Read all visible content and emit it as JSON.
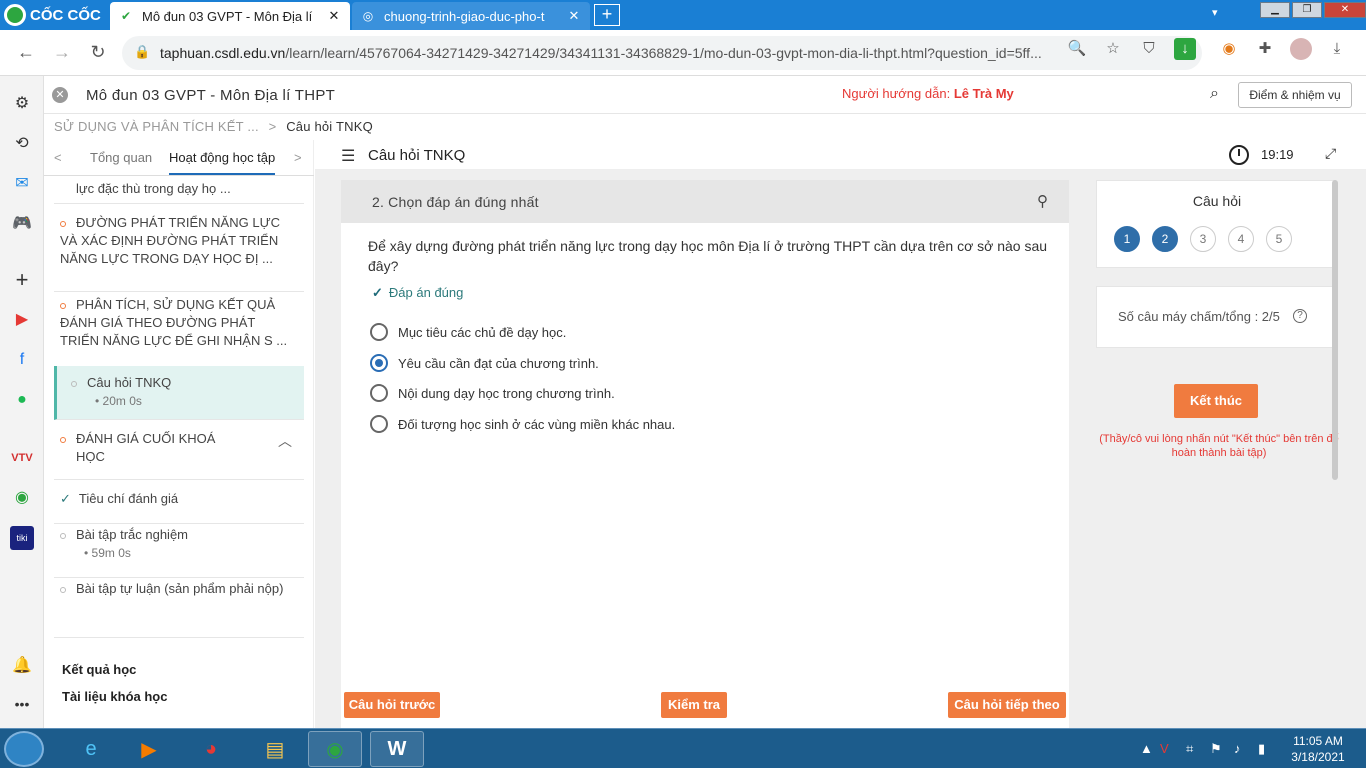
{
  "browser": {
    "logo": "CỐC CỐC",
    "tabs": [
      {
        "label": "Mô đun 03 GVPT - Môn Địa lí",
        "close": "✕"
      },
      {
        "label": "chuong-trinh-giao-duc-pho-t",
        "close": "✕"
      }
    ],
    "new_tab": "+",
    "url_host": "taphuan.csdl.edu.vn",
    "url_path": "/learn/learn/45767064-34271429-34271429/34341131-34368829-1/mo-dun-03-gvpt-mon-dia-li-thpt.html?question_id=5ff..."
  },
  "header": {
    "title": "Mô đun 03 GVPT - Môn Địa lí THPT",
    "guide_label": "Người hướng dẫn:",
    "guide_name": "Lê Trà My",
    "score_button": "Điểm & nhiệm vụ"
  },
  "breadcrumb": {
    "parent": "SỬ DỤNG VÀ PHÂN TÍCH KẾT ...",
    "sep": ">",
    "current": "Câu hỏi TNKQ"
  },
  "sidebar": {
    "tab_overview": "Tổng quan",
    "tab_activities": "Hoạt động học tập",
    "prev": "<",
    "next": ">",
    "items": [
      {
        "text": "lực đặc thù trong dạy họ ..."
      },
      {
        "text": "ĐƯỜNG PHÁT TRIỂN NĂNG LỰC VÀ XÁC ĐỊNH ĐƯỜNG PHÁT TRIỂN NĂNG LỰC TRONG DẠY HỌC ĐỊ ..."
      },
      {
        "text": "PHÂN TÍCH, SỬ DỤNG KẾT QUẢ ĐÁNH GIÁ THEO ĐƯỜNG PHÁT TRIỂN NĂNG LỰC ĐỂ GHI NHẬN S ..."
      },
      {
        "text": "Câu hỏi TNKQ",
        "duration": "• 20m 0s"
      },
      {
        "text": "ĐÁNH GIÁ CUỐI KHOÁ HỌC"
      },
      {
        "text": "Tiêu chí đánh giá"
      },
      {
        "text": "Bài tập trắc nghiệm",
        "duration": "• 59m 0s"
      },
      {
        "text": "Bài tập tự luận (sản phẩm phải nộp)"
      }
    ],
    "results": "Kết quả học",
    "materials": "Tài liệu khóa học"
  },
  "content": {
    "title": "Câu hỏi TNKQ",
    "timer": "19:19",
    "question_heading": "2. Chọn đáp án đúng nhất",
    "question_text": "Để xây dựng đường phát triển năng lực trong dạy học môn Địa lí ở trường THPT cần dựa trên cơ sở nào sau đây?",
    "correct_label": "Đáp án đúng",
    "options": [
      {
        "text": "Mục tiêu các chủ đề dạy học.",
        "selected": false
      },
      {
        "text": "Yêu cầu cần đạt của chương trình.",
        "selected": true
      },
      {
        "text": "Nội dung dạy học trong chương trình.",
        "selected": false
      },
      {
        "text": "Đối tượng học sinh ở các vùng miền khác nhau.",
        "selected": false
      }
    ],
    "btn_prev": "Câu hỏi trước",
    "btn_check": "Kiểm tra",
    "btn_next": "Câu hỏi tiếp theo"
  },
  "panel": {
    "title": "Câu hỏi",
    "questions": [
      {
        "n": "1",
        "done": true
      },
      {
        "n": "2",
        "done": true
      },
      {
        "n": "3",
        "done": false
      },
      {
        "n": "4",
        "done": false
      },
      {
        "n": "5",
        "done": false
      }
    ],
    "score_text": "Số câu máy chấm/tổng : 2/5",
    "end_button": "Kết thúc",
    "end_note": "(Thầy/cô vui lòng nhấn nút \"Kết thúc\" bên trên để hoàn thành bài tập)"
  },
  "taskbar": {
    "time": "11:05 AM",
    "date": "3/18/2021"
  },
  "colors": {
    "accent_orange": "#f07b3f",
    "accent_blue": "#2f6ea9",
    "guide_red": "#e53935",
    "browser_blue": "#1a7fd4"
  }
}
